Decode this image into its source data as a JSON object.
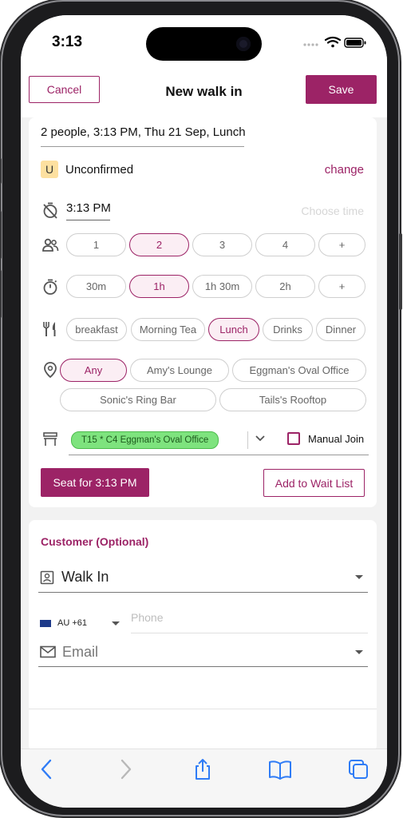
{
  "status_bar": {
    "time": "3:13"
  },
  "nav": {
    "cancel_label": "Cancel",
    "title": "New walk in",
    "save_label": "Save"
  },
  "booking": {
    "summary": "2 people, 3:13 PM, Thu 21 Sep, Lunch",
    "status_badge": "U",
    "status": "Unconfirmed",
    "change_label": "change",
    "time_value": "3:13 PM",
    "choose_time_placeholder": "Choose time",
    "party_sizes": [
      "1",
      "2",
      "3",
      "4",
      "+"
    ],
    "party_selected": "2",
    "durations": [
      "30m",
      "1h",
      "1h 30m",
      "2h",
      "+"
    ],
    "duration_selected": "1h",
    "services": [
      "breakfast",
      "Morning Tea",
      "Lunch",
      "Drinks",
      "Dinner"
    ],
    "service_selected": "Lunch",
    "areas": [
      "Any",
      "Amy's Lounge",
      "Eggman's Oval Office",
      "Sonic's Ring Bar",
      "Tails's Rooftop"
    ],
    "area_selected": "Any",
    "table_chip": "T15 * C4 Eggman's Oval Office",
    "manual_join_label": "Manual Join",
    "manual_join_checked": false,
    "seat_button": "Seat for 3:13 PM",
    "waitlist_button": "Add to Wait List"
  },
  "customer": {
    "title": "Customer (Optional)",
    "name_value": "Walk In",
    "country_code": "AU +61",
    "phone_placeholder": "Phone",
    "email_placeholder": "Email"
  },
  "theme": {
    "accent": "#9c2366",
    "accent_light": "#fbeef4",
    "table_green": "#7ee37e"
  },
  "icons": {
    "timer": "timer-off-icon",
    "people": "people-icon",
    "duration": "stopwatch-icon",
    "service": "cutlery-icon",
    "area": "location-pin-icon",
    "table": "table-icon",
    "contact": "contact-card-icon",
    "email": "email-icon"
  }
}
